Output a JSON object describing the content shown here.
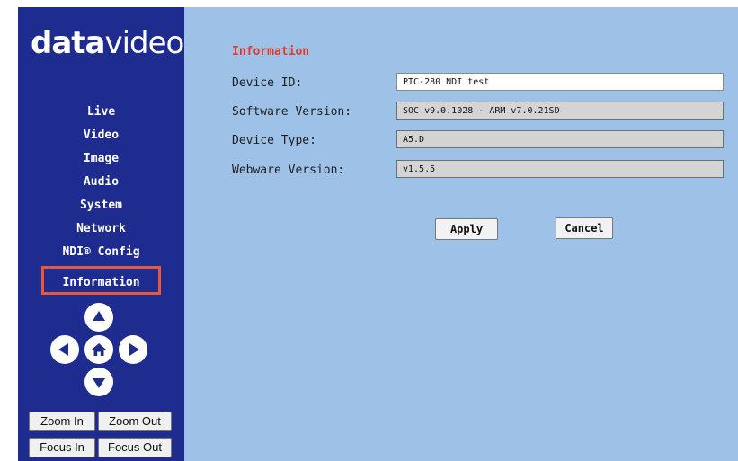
{
  "brand": {
    "logo_bold": "data",
    "logo_light": "video"
  },
  "sidebar": {
    "items": [
      {
        "label": "Live"
      },
      {
        "label": "Video"
      },
      {
        "label": "Image"
      },
      {
        "label": "Audio"
      },
      {
        "label": "System"
      },
      {
        "label": "Network"
      },
      {
        "label": "NDI® Config"
      },
      {
        "label": "Information",
        "active": true
      }
    ]
  },
  "ptz": {
    "icons": [
      "arrow-up-icon",
      "arrow-left-icon",
      "home-icon",
      "arrow-right-icon",
      "arrow-down-icon"
    ],
    "zoom_in": "Zoom In",
    "zoom_out": "Zoom Out",
    "focus_in": "Focus In",
    "focus_out": "Focus Out"
  },
  "info": {
    "title": "Information",
    "device_id": {
      "label": "Device ID:",
      "value": "PTC-280 NDI test"
    },
    "software_version": {
      "label": "Software Version:",
      "value": "SOC v9.0.1028 - ARM v7.0.21SD"
    },
    "device_type": {
      "label": "Device Type:",
      "value": "A5.D"
    },
    "webware_version": {
      "label": "Webware Version:",
      "value": "v1.5.5"
    }
  },
  "actions": {
    "apply": "Apply",
    "cancel": "Cancel"
  },
  "colors": {
    "sidebar_bg": "#1f2c8f",
    "main_bg": "#9ec1e8",
    "title_red": "#e23a2a",
    "highlight_border": "#e8573f"
  }
}
